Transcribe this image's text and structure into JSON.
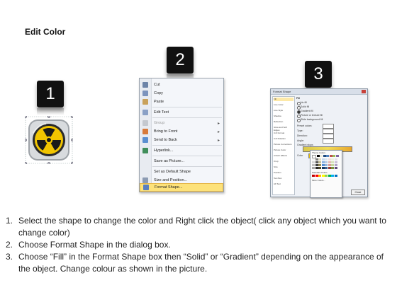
{
  "title": "Edit Color",
  "badges": [
    "1",
    "2",
    "3"
  ],
  "icon": "radiation-warning-icon",
  "context_menu": {
    "items": [
      {
        "label": "Cut",
        "icon": "scissors-icon",
        "submenu": false,
        "disabled": false
      },
      {
        "label": "Copy",
        "icon": "copy-icon",
        "submenu": false,
        "disabled": false
      },
      {
        "label": "Paste",
        "icon": "paste-icon",
        "submenu": false,
        "disabled": false
      },
      {
        "label": "Edit Text",
        "icon": "edit-text-icon",
        "submenu": false,
        "disabled": false
      },
      {
        "label": "Group",
        "icon": "group-icon",
        "submenu": true,
        "disabled": true
      },
      {
        "label": "Bring to Front",
        "icon": "bring-front-icon",
        "submenu": true,
        "disabled": false
      },
      {
        "label": "Send to Back",
        "icon": "send-back-icon",
        "submenu": true,
        "disabled": false
      },
      {
        "label": "Hyperlink...",
        "icon": "hyperlink-icon",
        "submenu": false,
        "disabled": false
      },
      {
        "label": "Save as Picture...",
        "icon": "",
        "submenu": false,
        "disabled": false
      },
      {
        "label": "Set as Default Shape",
        "icon": "",
        "submenu": false,
        "disabled": false
      },
      {
        "label": "Size and Position...",
        "icon": "size-icon",
        "submenu": false,
        "disabled": false
      },
      {
        "label": "Format Shape...",
        "icon": "format-shape-icon",
        "submenu": false,
        "disabled": false,
        "highlighted": true
      }
    ]
  },
  "format_dialog": {
    "title": "Format Shape",
    "categories": [
      "Fill",
      "Line Color",
      "Line Style",
      "Shadow",
      "Reflection",
      "Glow and Soft Edges",
      "3-D Format",
      "3-D Rotation",
      "Picture Corrections",
      "Picture Color",
      "Artistic Effects",
      "Crop",
      "Size",
      "Position",
      "Text Box",
      "Alt Text"
    ],
    "fill_label": "Fill",
    "options": [
      "No fill",
      "Solid fill",
      "Gradient fill",
      "Picture or texture fill",
      "Slide background fill"
    ],
    "selected_option": "Gradient fill",
    "fields": [
      "Preset colors:",
      "Type:",
      "Direction:",
      "Angle:",
      "Gradient stops"
    ],
    "color_label": "Color",
    "theme_colors_label": "Theme Colors",
    "standard_colors_label": "Standard Colors",
    "more_colors_label": "More Colors...",
    "close_label": "Close"
  },
  "instructions": [
    {
      "num": "1.",
      "text": "Select the shape to change the color and Right click the object( click any object which you want to change color)"
    },
    {
      "num": "2.",
      "text": "Choose Format Shape in the dialog box."
    },
    {
      "num": "3.",
      "text": "Choose “Fill” in the Format Shape box then “Solid” or “Gradient” depending on the appearance of the object. Change colour as shown in the picture."
    }
  ],
  "colors": {
    "badge": "#111111",
    "highlight": "#fde27a",
    "radiation_yellow": "#f2c500"
  }
}
